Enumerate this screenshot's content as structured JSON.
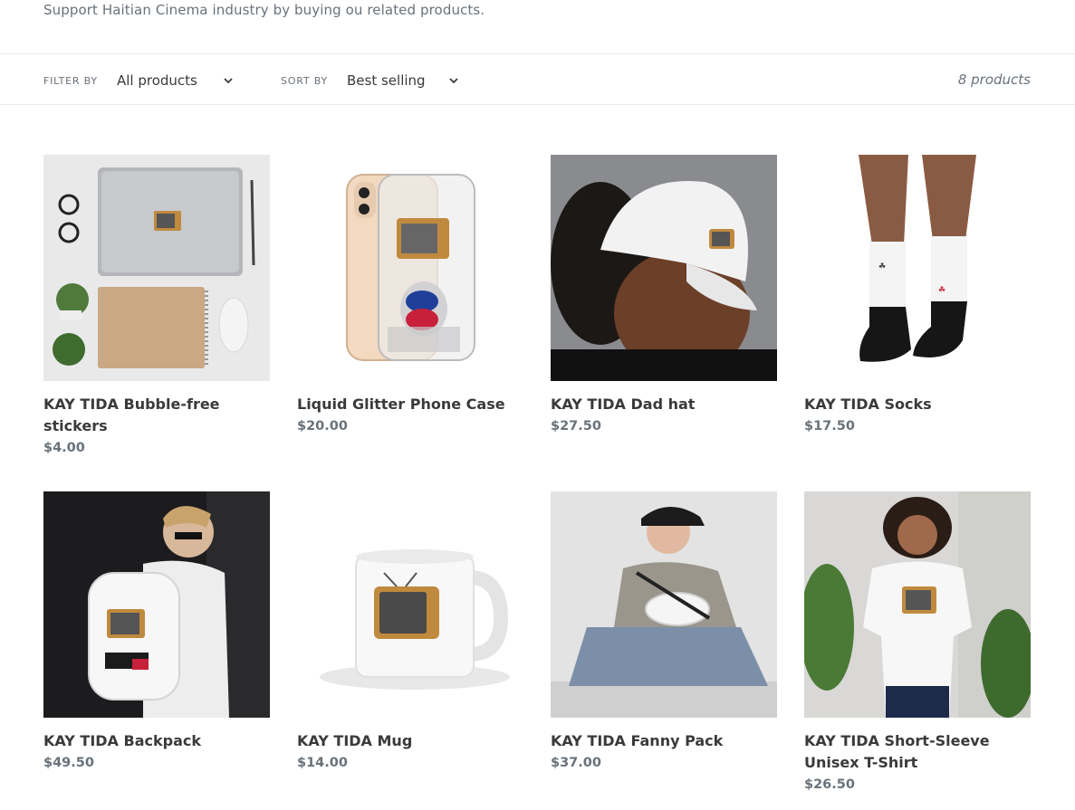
{
  "collection": {
    "description": "Support Haitian Cinema industry by buying ou related products."
  },
  "toolbar": {
    "filter_label": "FILTER BY",
    "filter_value": "All products",
    "sort_label": "SORT BY",
    "sort_value": "Best selling",
    "product_count": "8 products"
  },
  "products": [
    {
      "title": "KAY TIDA Bubble-free stickers",
      "price": "$4.00",
      "image": "stickers-flatlay-image"
    },
    {
      "title": "Liquid Glitter Phone Case",
      "price": "$20.00",
      "image": "phone-case-image"
    },
    {
      "title": "KAY TIDA Dad hat",
      "price": "$27.50",
      "image": "dad-hat-image"
    },
    {
      "title": "KAY TIDA Socks",
      "price": "$17.50",
      "image": "socks-image"
    },
    {
      "title": "KAY TIDA Backpack",
      "price": "$49.50",
      "image": "backpack-image"
    },
    {
      "title": "KAY TIDA Mug",
      "price": "$14.00",
      "image": "mug-image"
    },
    {
      "title": "KAY TIDA Fanny Pack",
      "price": "$37.00",
      "image": "fanny-pack-image"
    },
    {
      "title": "KAY TIDA Short-Sleeve Unisex T-Shirt",
      "price": "$26.50",
      "image": "t-shirt-image"
    }
  ],
  "colors": {
    "text": "#3a3a3a",
    "muted": "#69727b",
    "border": "#e8e9eb"
  }
}
